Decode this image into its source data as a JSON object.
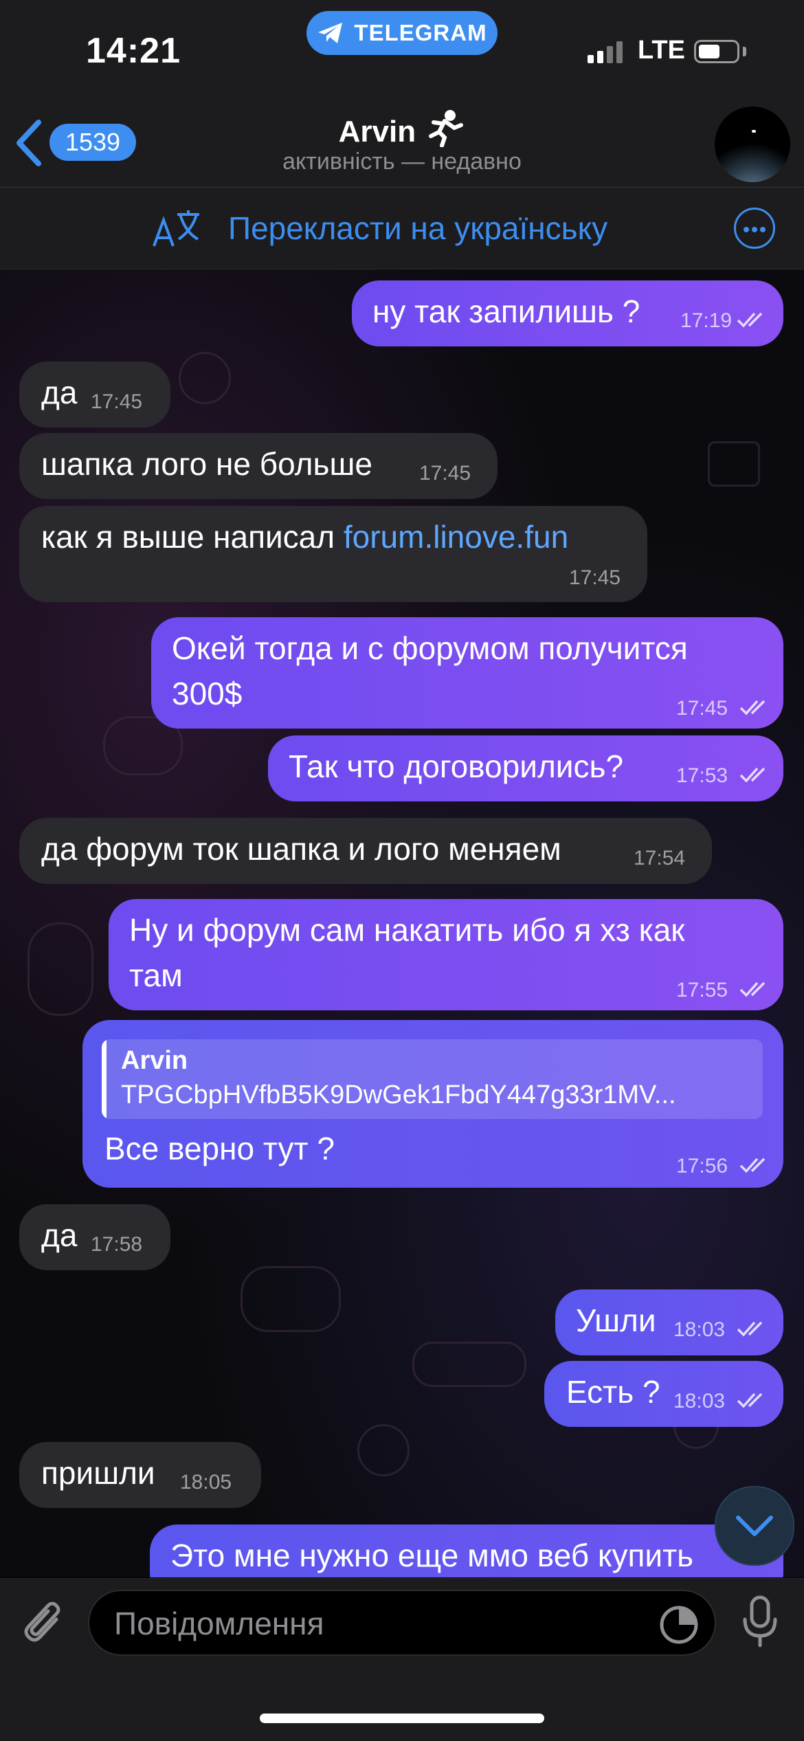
{
  "status_bar": {
    "time": "14:21",
    "app_pill": "TELEGRAM",
    "network": "LTE"
  },
  "header": {
    "back_count": "1539",
    "name": "Arvin",
    "status": "активність — недавно"
  },
  "translate_bar": {
    "label": "Перекласти на українську"
  },
  "messages": [
    {
      "dir": "out",
      "text": "ну так запилишь ?",
      "time": "17:19"
    },
    {
      "dir": "in",
      "text": "да",
      "time": "17:45"
    },
    {
      "dir": "in",
      "text": "шапка лого не больше",
      "time": "17:45"
    },
    {
      "dir": "in",
      "text": "как я выше написал ",
      "link": "forum.linove.fun",
      "time": "17:45"
    },
    {
      "dir": "out",
      "line1": "Окей тогда и с форумом получится",
      "line2": "300$",
      "time": "17:45"
    },
    {
      "dir": "out",
      "text": "Так что договорились?",
      "time": "17:53"
    },
    {
      "dir": "in",
      "text": "да форум ток шапка и лого меняем",
      "time": "17:54"
    },
    {
      "dir": "out",
      "line1": "Ну и форум сам накатить ибо я хз как",
      "line2": "там",
      "time": "17:55"
    },
    {
      "dir": "out",
      "reply_name": "Arvin",
      "reply_text": "TPGCbpHVfbB5K9DwGek1FbdY447g33r1MV...",
      "text": "Все верно тут ?",
      "time": "17:56"
    },
    {
      "dir": "in",
      "text": "да",
      "time": "17:58"
    },
    {
      "dir": "out",
      "text": "Ушли",
      "time": "18:03"
    },
    {
      "dir": "out",
      "text": "Есть ?",
      "time": "18:03"
    },
    {
      "dir": "in",
      "text": "пришли",
      "time": "18:05"
    },
    {
      "dir": "out",
      "text": "Это мне нужно еще ммо веб купить"
    }
  ],
  "composer": {
    "placeholder": "Повідомлення"
  }
}
